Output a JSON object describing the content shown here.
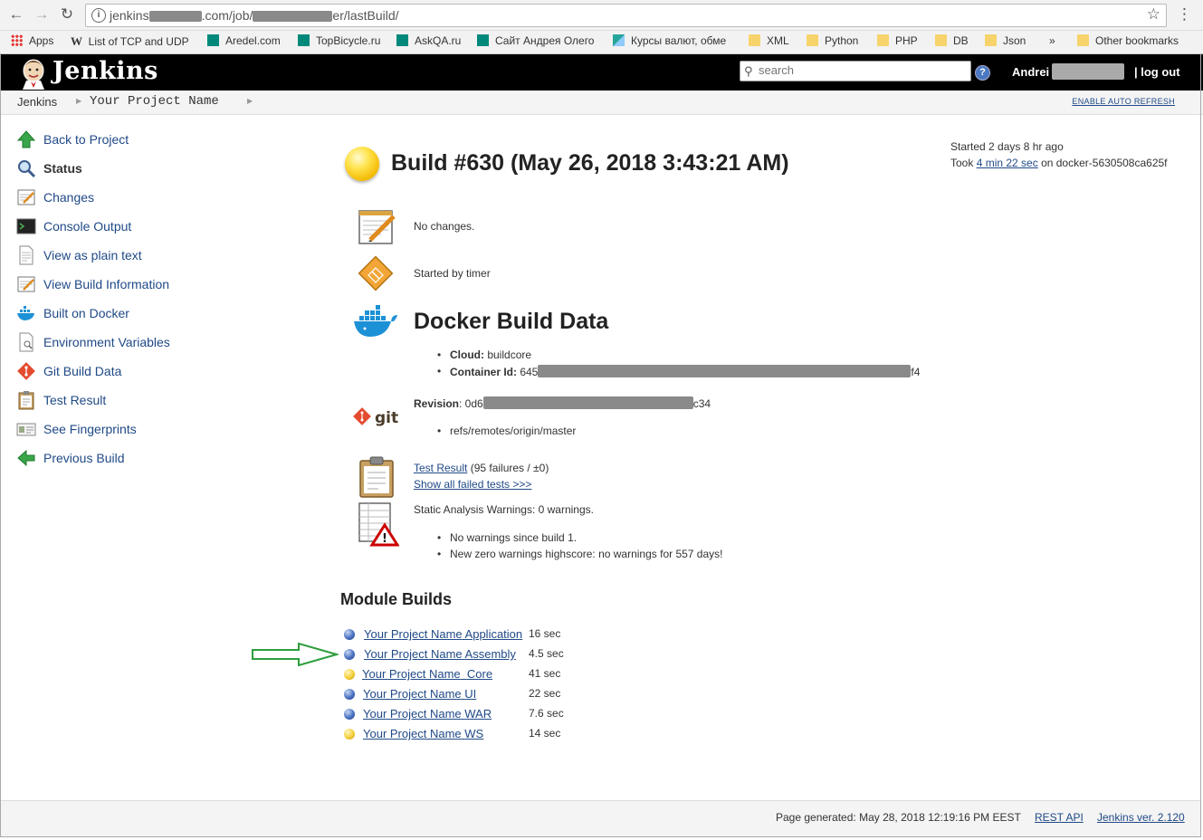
{
  "browser": {
    "url_prefix": "jenkins",
    "url_mid": ".com/job/",
    "url_suffix": "er/lastBuild/",
    "bookmarks": [
      {
        "label": "Apps",
        "icon": "apps-grid-icon"
      },
      {
        "label": "List of TCP and UDP",
        "icon": "wikipedia-icon"
      },
      {
        "label": "Aredel.com",
        "icon": "teal-square-icon"
      },
      {
        "label": "TopBicycle.ru",
        "icon": "teal-square-icon"
      },
      {
        "label": "AskQA.ru",
        "icon": "teal-square-icon"
      },
      {
        "label": "Сайт Андрея Олего",
        "icon": "teal-square-icon"
      },
      {
        "label": "Курсы валют, обме",
        "icon": "chart-icon"
      },
      {
        "label": "XML",
        "icon": "folder-icon"
      },
      {
        "label": "Python",
        "icon": "folder-icon"
      },
      {
        "label": "PHP",
        "icon": "folder-icon"
      },
      {
        "label": "DB",
        "icon": "folder-icon"
      },
      {
        "label": "Json",
        "icon": "folder-icon"
      },
      {
        "label": "»",
        "icon": ""
      },
      {
        "label": "Other bookmarks",
        "icon": "folder-icon"
      }
    ]
  },
  "header": {
    "title": "Jenkins",
    "search_placeholder": "search",
    "user": "Andrei",
    "logout": "| log out"
  },
  "breadcrumbs": {
    "root": "Jenkins",
    "project": "Your Project Name",
    "auto_refresh": "ENABLE AUTO REFRESH"
  },
  "sidebar": [
    {
      "label": "Back to Project",
      "icon": "up-arrow-icon"
    },
    {
      "label": "Status",
      "icon": "magnifier-icon"
    },
    {
      "label": "Changes",
      "icon": "notepad-icon"
    },
    {
      "label": "Console Output",
      "icon": "terminal-icon"
    },
    {
      "label": "View as plain text",
      "icon": "document-icon"
    },
    {
      "label": "View Build Information",
      "icon": "notepad-icon"
    },
    {
      "label": "Built on Docker",
      "icon": "docker-icon"
    },
    {
      "label": "Environment Variables",
      "icon": "document-search-icon"
    },
    {
      "label": "Git Build Data",
      "icon": "git-icon"
    },
    {
      "label": "Test Result",
      "icon": "clipboard-icon"
    },
    {
      "label": "See Fingerprints",
      "icon": "fingerprint-icon"
    },
    {
      "label": "Previous Build",
      "icon": "left-arrow-icon"
    }
  ],
  "build": {
    "title": "Build #630 (May 26, 2018 3:43:21 AM)",
    "started": "Started 2 days 8 hr ago",
    "took_prefix": "Took ",
    "took_link": "4 min 22 sec",
    "took_suffix": " on docker-5630508ca625f",
    "changes": "No changes.",
    "cause": "Started by timer"
  },
  "docker": {
    "title": "Docker Build Data",
    "cloud_label": "Cloud:",
    "cloud_value": " buildcore",
    "container_label": "Container Id:",
    "container_start": " 645",
    "container_end": "f4"
  },
  "git": {
    "revision_label": "Revision",
    "revision_start": ": 0d6",
    "revision_end": "c34",
    "ref": "refs/remotes/origin/master"
  },
  "tests": {
    "link": "Test Result",
    "summary": " (95 failures / ±0)",
    "show_failed": "Show all failed tests >>>"
  },
  "analysis": {
    "title": "Static Analysis Warnings: 0 warnings.",
    "items": [
      "No warnings since build 1.",
      "New zero warnings highscore: no warnings for 557 days!"
    ]
  },
  "modules": {
    "title": "Module Builds",
    "rows": [
      {
        "prefix": "Your Project Name",
        "name": "Application",
        "time": "16 sec",
        "status": "blue"
      },
      {
        "prefix": "Your Project Name",
        "name": "Assembly",
        "time": "4.5 sec",
        "status": "blue"
      },
      {
        "prefix": "Your Project Name",
        "name": "Core",
        "time": "41 sec",
        "status": "yellow"
      },
      {
        "prefix": "Your Project Name",
        "name": "UI",
        "time": "22 sec",
        "status": "blue"
      },
      {
        "prefix": "Your Project Name",
        "name": "WAR",
        "time": "7.6 sec",
        "status": "blue"
      },
      {
        "prefix": "Your Project Name",
        "name": "WS",
        "time": "14 sec",
        "status": "yellow"
      }
    ]
  },
  "footer": {
    "generated": "Page generated: May 28, 2018 12:19:16 PM EEST",
    "rest_api": "REST API",
    "version": "Jenkins ver. 2.120"
  },
  "colors": {
    "header_bg": "#000000",
    "link": "#204a87",
    "arrow": "#2e9e3e"
  }
}
